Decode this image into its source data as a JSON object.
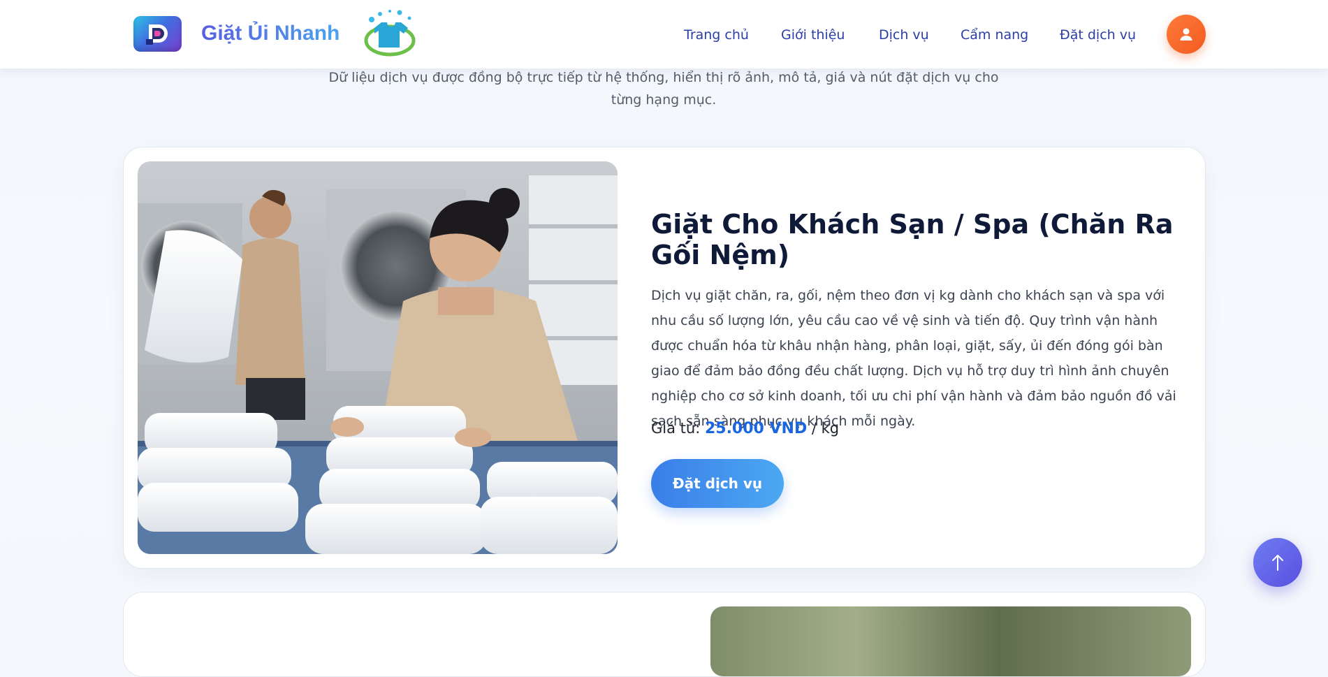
{
  "brand": {
    "name": "Giặt Ủi Nhanh",
    "logo_icon": "gradient-d-logo-icon",
    "mascot_icon": "laundry-shirt-splash-icon"
  },
  "nav": {
    "items": [
      {
        "label": "Trang chủ"
      },
      {
        "label": "Giới thiệu"
      },
      {
        "label": "Dịch vụ"
      },
      {
        "label": "Cẩm nang"
      },
      {
        "label": "Đặt dịch vụ"
      }
    ],
    "user_icon": "user-icon"
  },
  "intro": {
    "subtitle": "Dữ liệu dịch vụ được đồng bộ trực tiếp từ hệ thống, hiển thị rõ ảnh, mô tả, giá và nút đặt dịch vụ cho từng hạng mục."
  },
  "service": {
    "title": "Giặt Cho Khách Sạn / Spa (Chăn Ra Gối Nệm)",
    "description": "Dịch vụ giặt chăn, ra, gối, nệm theo đơn vị kg dành cho khách sạn và spa với nhu cầu số lượng lớn, yêu cầu cao về vệ sinh và tiến độ. Quy trình vận hành được chuẩn hóa từ khâu nhận hàng, phân loại, giặt, sấy, ủi đến đóng gói bàn giao để đảm bảo đồng đều chất lượng. Dịch vụ hỗ trợ duy trì hình ảnh chuyên nghiệp cho cơ sở kinh doanh, tối ưu chi phí vận hành và đảm bảo nguồn đồ vải sạch sẵn sàng phục vụ khách mỗi ngày.",
    "price_prefix": "Giá từ: ",
    "price_value": "25.000 VND",
    "price_unit": " / kg",
    "order_label": "Đặt dịch vụ"
  },
  "colors": {
    "accent_blue": "#1a66e0",
    "brand_gradient_start": "#5a5fe0",
    "avatar_orange": "#f25b1f",
    "scroll_top_purple": "#5a4fe0"
  },
  "scroll_top_icon": "arrow-up-icon"
}
